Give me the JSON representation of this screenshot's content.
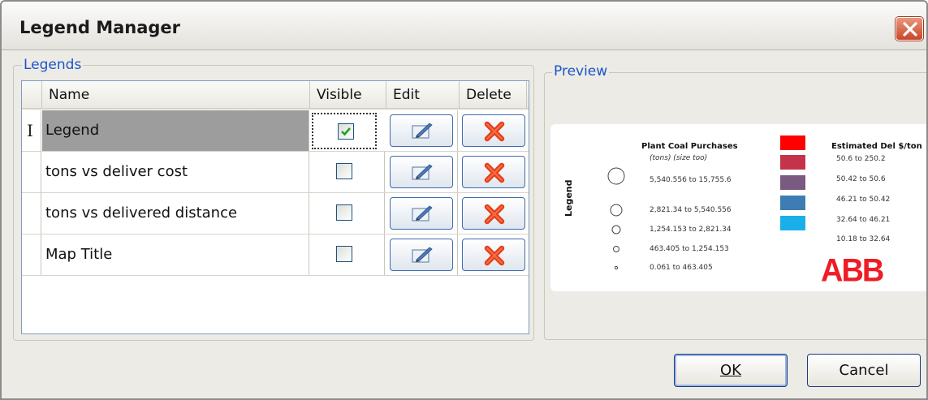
{
  "window": {
    "title": "Legend Manager"
  },
  "legends_group": {
    "label": "Legends"
  },
  "preview_group": {
    "label": "Preview"
  },
  "grid": {
    "columns": [
      "Name",
      "Visible",
      "Edit",
      "Delete"
    ],
    "rows": [
      {
        "name": "Legend",
        "visible": true
      },
      {
        "name": "tons vs deliver cost",
        "visible": false
      },
      {
        "name": "tons vs delivered distance",
        "visible": false
      },
      {
        "name": "Map Title",
        "visible": false
      }
    ]
  },
  "preview": {
    "vertical_label": "Legend",
    "left_title": "Plant Coal Purchases",
    "left_subtitle": "(tons) (size too)",
    "left_items": [
      "5,540.556 to 15,755.6",
      "2,821.34 to 5,540.556",
      "1,254.153 to 2,821.34",
      "463.405 to 1,254.153",
      "0.061 to 463.405"
    ],
    "right_title": "Estimated Del $/ton",
    "right_items": [
      "50.6 to 250.2",
      "50.42 to 50.6",
      "46.21 to 50.42",
      "32.64 to 46.21",
      "10.18 to 32.64"
    ],
    "swatch_colors": [
      "#ff0000",
      "#c43349",
      "#7a5a80",
      "#3e7db3",
      "#19b0e9"
    ],
    "logo": "ABB"
  },
  "buttons": {
    "ok": "OK",
    "cancel": "Cancel"
  }
}
